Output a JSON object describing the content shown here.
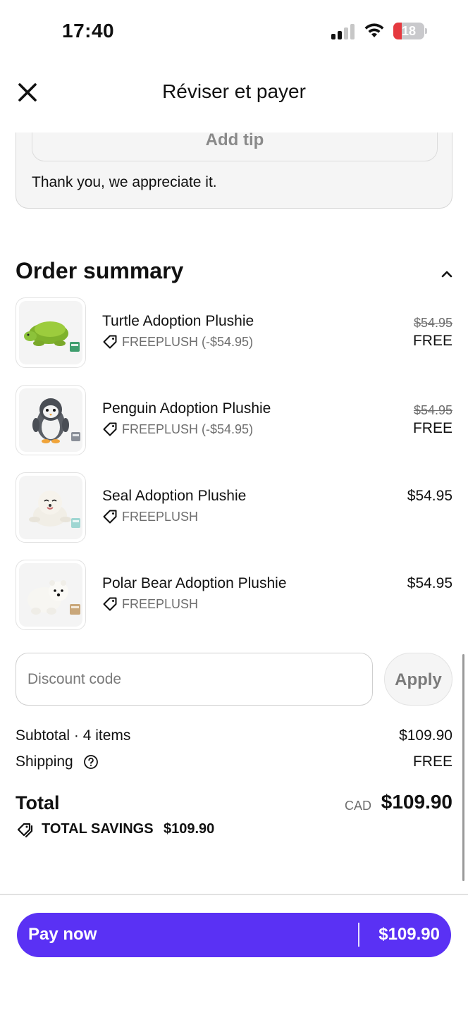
{
  "status_bar": {
    "time": "17:40",
    "battery_level": "18",
    "battery_color": "#e5393f",
    "signal_icon": "cellular-signal-icon",
    "wifi_icon": "wifi-icon"
  },
  "header": {
    "title": "Réviser et payer",
    "close_icon": "close-icon"
  },
  "tip": {
    "button_label": "Add tip",
    "thanks_text": "Thank you, we appreciate it."
  },
  "order_summary": {
    "title": "Order summary",
    "collapse_icon": "chevron-up-icon",
    "items": [
      {
        "name": "Turtle Adoption Plushie",
        "code": "FREEPLUSH (-$54.95)",
        "original_price": "$54.95",
        "price": "FREE"
      },
      {
        "name": "Penguin Adoption Plushie",
        "code": "FREEPLUSH (-$54.95)",
        "original_price": "$54.95",
        "price": "FREE"
      },
      {
        "name": "Seal Adoption Plushie",
        "code": "FREEPLUSH",
        "price": "$54.95"
      },
      {
        "name": "Polar Bear Adoption Plushie",
        "code": "FREEPLUSH",
        "price": "$54.95"
      }
    ]
  },
  "discount": {
    "placeholder": "Discount code",
    "apply_label": "Apply"
  },
  "totals": {
    "subtotal_label": "Subtotal · 4 items",
    "subtotal_value": "$109.90",
    "shipping_label": "Shipping",
    "shipping_value": "FREE",
    "total_label": "Total",
    "currency": "CAD",
    "total_value": "$109.90",
    "savings_label": "TOTAL SAVINGS",
    "savings_value": "$109.90"
  },
  "pay": {
    "label": "Pay now",
    "amount": "$109.90",
    "color": "#5a31f4"
  }
}
